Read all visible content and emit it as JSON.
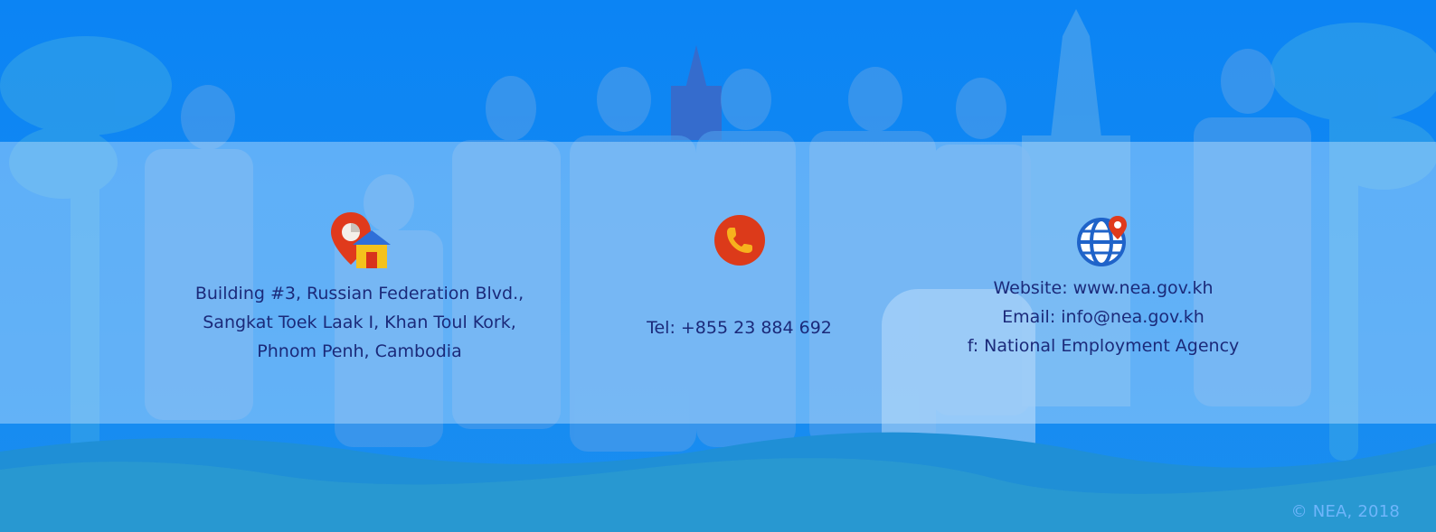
{
  "colors": {
    "background": "#0f86f3",
    "band": "rgba(205,230,255,0.42)",
    "text": "#1b2a7a",
    "icon_red": "#e03a1c",
    "icon_globe": "#1f63c9"
  },
  "address": {
    "icon": "location-home-icon",
    "lines": [
      "Building #3, Russian Federation Blvd.,",
      "Sangkat Toek Laak I, Khan Toul Kork,",
      "Phnom Penh, Cambodia"
    ]
  },
  "phone": {
    "icon": "phone-icon",
    "text": "Tel: +855 23 884 692"
  },
  "web": {
    "icon": "globe-pin-icon",
    "website": "Website: www.nea.gov.kh",
    "email": "Email: info@nea.gov.kh",
    "facebook": "f: National Employment Agency"
  },
  "footer": {
    "copyright": "© NEA, 2018"
  }
}
